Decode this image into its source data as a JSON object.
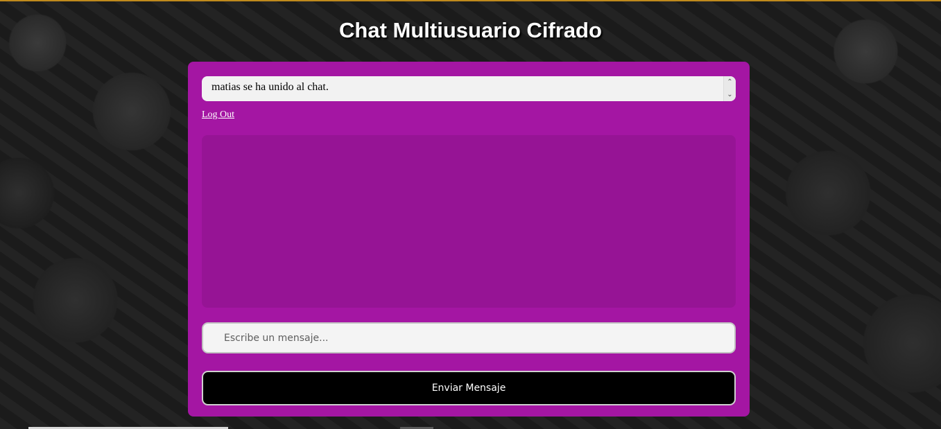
{
  "page": {
    "title": "Chat Multiusuario Cifrado"
  },
  "notice": {
    "text": "matias se ha unido al chat.",
    "scroll_up_icon": "chevron-up-icon",
    "scroll_down_icon": "chevron-down-icon"
  },
  "auth": {
    "logout_label": "Log Out"
  },
  "messages": [],
  "composer": {
    "placeholder": "Escribe un mensaje...",
    "value": "",
    "send_label": "Enviar Mensaje"
  },
  "colors": {
    "panel": "#a416a3",
    "messages_area": "#961495",
    "button": "#000000",
    "accent_line": "#c08a1c"
  }
}
